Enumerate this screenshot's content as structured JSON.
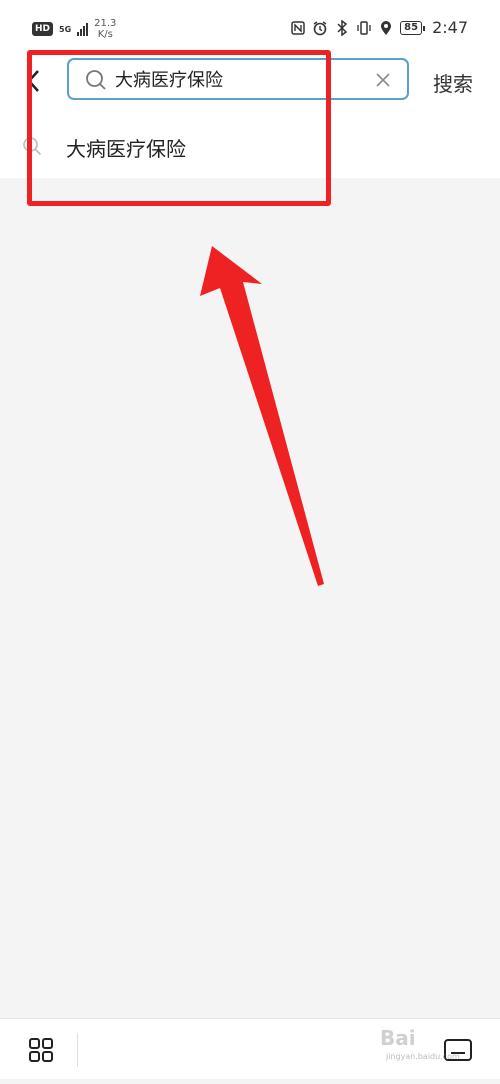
{
  "status_bar": {
    "hd": "HD",
    "network": "5G",
    "speed_value": "21.3",
    "speed_unit": "K/s",
    "battery": "85",
    "time": "2:47"
  },
  "search": {
    "query": "大病医疗保险",
    "button_label": "搜索"
  },
  "suggestions": [
    {
      "label": "大病医疗保险"
    }
  ],
  "watermark": {
    "brand": "Bai",
    "sub": "jingyan.baidu.com"
  },
  "colors": {
    "accent_border": "#5aa0c8",
    "annotation_red": "#ee2222",
    "background": "#f4f4f4"
  }
}
